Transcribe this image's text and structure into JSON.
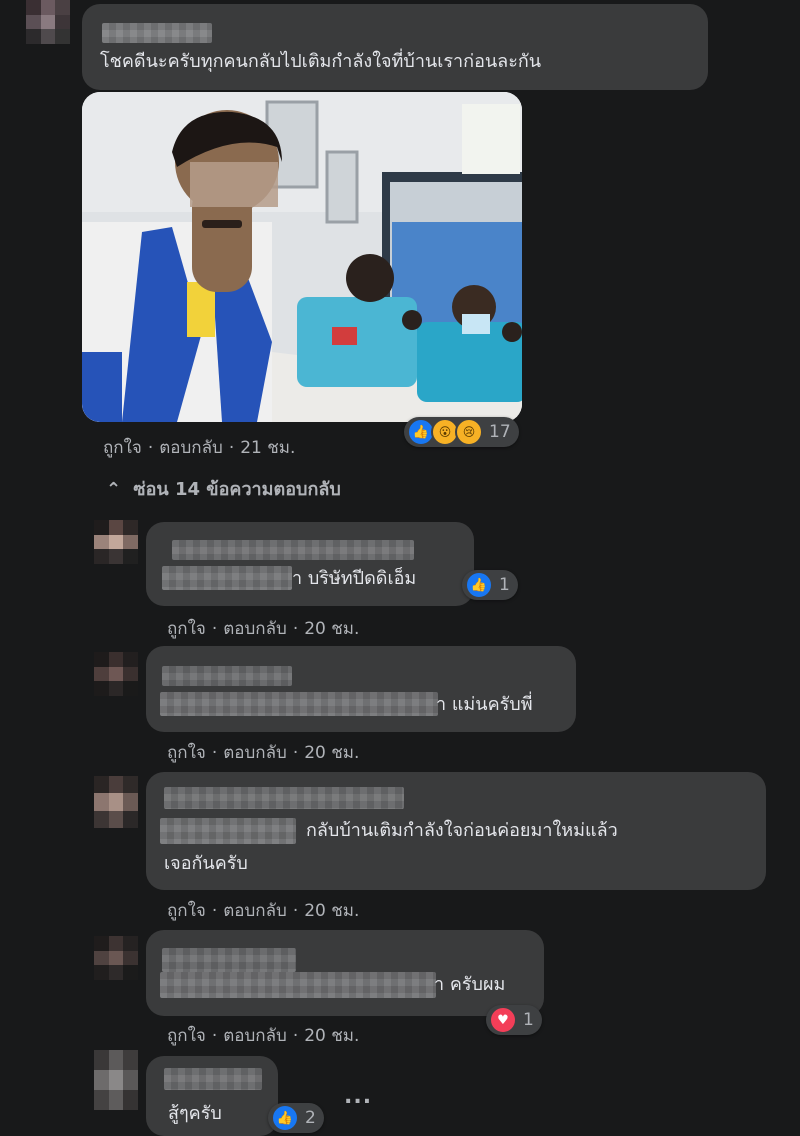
{
  "comments": [
    {
      "text_lines": [
        "โชคดีนะครับทุกคนกลับไปเติมกำลังใจที่บ้านเราก่อนละกัน"
      ],
      "like_label": "ถูกใจ",
      "reply_label": "ตอบกลับ",
      "time": "21 ชม.",
      "reaction_count": "17",
      "reactions": [
        "like-icon",
        "wow-icon",
        "sad-icon"
      ]
    },
    {
      "text_lines": [
        "า บริษัทปีดดิเอ็ม"
      ],
      "like_label": "ถูกใจ",
      "reply_label": "ตอบกลับ",
      "time": "20 ชม.",
      "reaction_count": "1",
      "reactions": [
        "like-icon"
      ]
    },
    {
      "text_lines": [
        "า แม่นครับพี่"
      ],
      "like_label": "ถูกใจ",
      "reply_label": "ตอบกลับ",
      "time": "20 ชม."
    },
    {
      "text_lines": [
        "กลับบ้านเติมกำลังใจก่อนค่อยมาใหม่แล้ว",
        "เจอกันครับ"
      ],
      "like_label": "ถูกใจ",
      "reply_label": "ตอบกลับ",
      "time": "20 ชม."
    },
    {
      "text_lines": [
        "า ครับผม"
      ],
      "like_label": "ถูกใจ",
      "reply_label": "ตอบกลับ",
      "time": "20 ชม.",
      "reaction_count": "1",
      "reactions": [
        "heart-icon"
      ]
    },
    {
      "text_lines": [
        "สู้ๆครับ"
      ],
      "reaction_count": "2",
      "reactions": [
        "like-icon"
      ]
    }
  ],
  "replies_toggle": {
    "icon": "chevron-up-icon",
    "label": "ซ่อน 14 ข้อความตอบกลับ"
  },
  "more_options": "...",
  "colors": {
    "background": "#18191a",
    "bubble": "#3a3b3c",
    "meta": "#b0b3b8",
    "like": "#1877f2",
    "love": "#f33e58"
  }
}
